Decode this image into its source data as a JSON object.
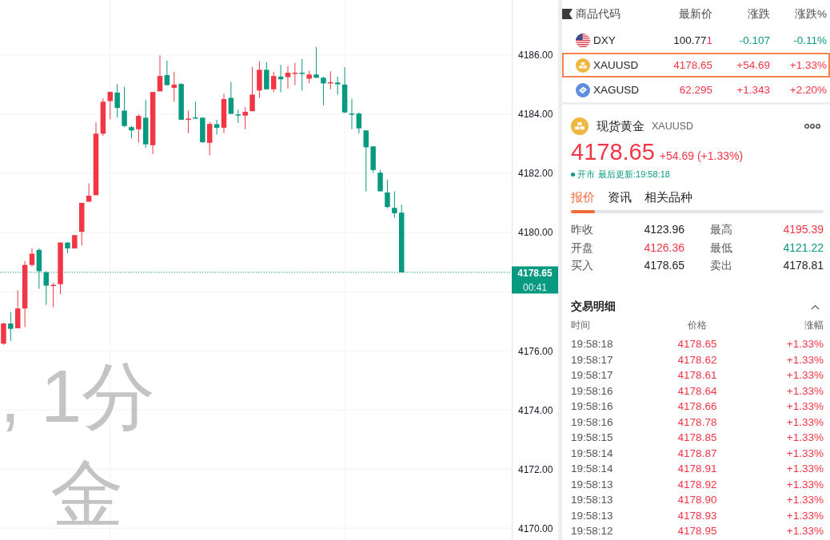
{
  "chart": {
    "watermark": [
      ", 1分",
      "金"
    ],
    "countdown": "00:41",
    "chart_data": {
      "type": "candlestick",
      "grid": true,
      "ylim": [
        4169.6,
        4187.86
      ],
      "yticks": [
        {
          "value": 4170,
          "label": "4170.00"
        },
        {
          "value": 4172,
          "label": "4172.00"
        },
        {
          "value": 4174,
          "label": "4174.00"
        },
        {
          "value": 4176,
          "label": "4176.00"
        },
        {
          "value": 4180,
          "label": "4180.00"
        },
        {
          "value": 4182,
          "label": "4182.00"
        },
        {
          "value": 4184,
          "label": "4184.00"
        },
        {
          "value": 4186,
          "label": "4186.00"
        }
      ],
      "ohlc": [
        [
          4176.24,
          4176.95,
          4176.2,
          4176.92
        ],
        [
          4176.92,
          4177.3,
          4176.33,
          4176.74
        ],
        [
          4176.76,
          4178.04,
          4176.76,
          4177.43
        ],
        [
          4177.43,
          4179.03,
          4176.8,
          4178.9
        ],
        [
          4178.9,
          4179.46,
          4178.85,
          4179.28
        ],
        [
          4179.41,
          4179.46,
          4178.09,
          4178.69
        ],
        [
          4178.65,
          4178.69,
          4177.55,
          4178.2
        ],
        [
          4178.2,
          4178.29,
          4177.47,
          4178.23
        ],
        [
          4178.25,
          4179.66,
          4177.91,
          4179.66
        ],
        [
          4179.66,
          4179.66,
          4179.3,
          4179.46
        ],
        [
          4179.46,
          4179.91,
          4179.46,
          4179.91
        ],
        [
          4180.02,
          4181.0,
          4179.56,
          4181.0
        ],
        [
          4181.04,
          4181.66,
          4181.04,
          4181.24
        ],
        [
          4181.26,
          4183.72,
          4181.26,
          4183.34
        ],
        [
          4183.34,
          4184.53,
          4183.27,
          4184.42
        ],
        [
          4184.44,
          4184.77,
          4183.83,
          4184.75
        ],
        [
          4184.73,
          4185.02,
          4183.88,
          4184.21
        ],
        [
          4184.12,
          4184.93,
          4183.56,
          4183.6
        ],
        [
          4183.56,
          4183.6,
          4183.18,
          4183.45
        ],
        [
          4183.49,
          4183.99,
          4183.04,
          4183.94
        ],
        [
          4183.88,
          4184.48,
          4182.86,
          4182.98
        ],
        [
          4182.95,
          4184.75,
          4182.65,
          4184.75
        ],
        [
          4184.77,
          4185.99,
          4184.77,
          4185.29
        ],
        [
          4185.32,
          4185.81,
          4184.98,
          4184.98
        ],
        [
          4184.89,
          4185.43,
          4184.42,
          4185.0
        ],
        [
          4185.02,
          4185.05,
          4183.81,
          4183.81
        ],
        [
          4183.82,
          4184.12,
          4183.36,
          4183.85
        ],
        [
          4183.89,
          4184.42,
          4183.86,
          4183.86
        ],
        [
          4183.88,
          4183.88,
          4183.03,
          4183.05
        ],
        [
          4183.03,
          4183.74,
          4182.61,
          4183.67
        ],
        [
          4183.66,
          4183.81,
          4183.31,
          4183.54
        ],
        [
          4183.54,
          4184.69,
          4183.36,
          4184.51
        ],
        [
          4184.55,
          4185.09,
          4184.01,
          4184.01
        ],
        [
          4183.99,
          4184.15,
          4183.7,
          4183.95
        ],
        [
          4183.95,
          4184.24,
          4183.49,
          4184.08
        ],
        [
          4184.1,
          4185.59,
          4184.1,
          4184.66
        ],
        [
          4184.8,
          4185.79,
          4184.55,
          4185.5
        ],
        [
          4185.5,
          4185.76,
          4184.84,
          4184.84
        ],
        [
          4184.84,
          4185.43,
          4184.74,
          4185.29
        ],
        [
          4185.27,
          4185.67,
          4184.74,
          4185.18
        ],
        [
          4185.25,
          4185.63,
          4184.87,
          4185.4
        ],
        [
          4185.38,
          4185.73,
          4184.98,
          4185.4
        ],
        [
          4185.4,
          4185.86,
          4184.8,
          4185.37
        ],
        [
          4185.2,
          4185.47,
          4185.04,
          4185.34
        ],
        [
          4185.34,
          4186.27,
          4185.23,
          4185.23
        ],
        [
          4185.23,
          4185.27,
          4184.3,
          4185.04
        ],
        [
          4185.05,
          4185.45,
          4184.84,
          4185.08
        ],
        [
          4185.07,
          4185.27,
          4184.66,
          4185.01
        ],
        [
          4185.0,
          4185.59,
          4184.03,
          4184.06
        ],
        [
          4184.02,
          4184.51,
          4183.49,
          4183.99
        ],
        [
          4184.02,
          4184.06,
          4183.34,
          4183.52
        ],
        [
          4183.45,
          4183.45,
          4181.39,
          4182.88
        ],
        [
          4182.91,
          4182.91,
          4182.01,
          4182.11
        ],
        [
          4182.02,
          4182.11,
          4181.39,
          4181.39
        ],
        [
          4181.35,
          4181.78,
          4180.82,
          4180.86
        ],
        [
          4180.83,
          4181.39,
          4180.49,
          4180.65
        ],
        [
          4180.67,
          4180.94,
          4178.65,
          4178.65
        ],
        null,
        null,
        null,
        null,
        null,
        null,
        null,
        null,
        null,
        null,
        null,
        null,
        null,
        null,
        null
      ],
      "ref_lines": [
        {
          "axis": "y",
          "value": 4178.65,
          "label": "4178.65",
          "color": "#089981",
          "line_style": "dotted"
        }
      ]
    }
  },
  "watchlist": {
    "columns": [
      "商品代码",
      "最新价",
      "涨跌",
      "涨跌%"
    ],
    "rows": [
      {
        "kind": "index",
        "symbol": "DXY",
        "price_parts": [
          {
            "text": "100.77",
            "color": "#222222"
          },
          {
            "text": "1",
            "color": "#f23645"
          }
        ],
        "change": "-0.107",
        "change_pct": "-0.11%",
        "color": "#089981",
        "selected": false
      },
      {
        "kind": "gold",
        "symbol": "XAUUSD",
        "price_parts": [
          {
            "text": "4178.65",
            "color": "#f23645"
          }
        ],
        "change": "+54.69",
        "change_pct": "+1.33%",
        "color": "#f23645",
        "selected": true
      },
      {
        "kind": "silver",
        "symbol": "XAGUSD",
        "price_parts": [
          {
            "text": "62.295",
            "color": "#f23645"
          }
        ],
        "change": "+1.343",
        "change_pct": "+2.20%",
        "color": "#f23645",
        "selected": false
      }
    ]
  },
  "quote": {
    "kind": "gold",
    "name": "现货黄金",
    "symbol": "XAUUSD",
    "price": "4178.65",
    "change": "+54.69 (+1.33%)",
    "color": "#f23645",
    "market_open": true,
    "status": "开市",
    "updated": "最后更新:19:58:18",
    "tabs": [
      {
        "label": "报价",
        "selected": true
      },
      {
        "label": "资讯",
        "selected": false
      },
      {
        "label": "相关品种",
        "selected": false
      }
    ],
    "stats": [
      {
        "label": "昨收",
        "value": "4123.96",
        "color": "#222222"
      },
      {
        "label": "最高",
        "value": "4195.39",
        "color": "#f23645"
      },
      {
        "label": "开盘",
        "value": "4126.36",
        "color": "#f23645"
      },
      {
        "label": "最低",
        "value": "4121.22",
        "color": "#089981"
      },
      {
        "label": "买入",
        "value": "4178.65",
        "color": "#222222"
      },
      {
        "label": "卖出",
        "value": "4178.81",
        "color": "#222222"
      }
    ]
  },
  "trades": {
    "title": "交易明细",
    "expanded": true,
    "columns": [
      "时间",
      "价格",
      "涨幅"
    ],
    "rows": [
      {
        "time": "19:58:18",
        "price": "4178.65",
        "change_pct": "+1.33%",
        "color": "#f23645"
      },
      {
        "time": "19:58:17",
        "price": "4178.62",
        "change_pct": "+1.33%",
        "color": "#f23645"
      },
      {
        "time": "19:58:17",
        "price": "4178.61",
        "change_pct": "+1.33%",
        "color": "#f23645"
      },
      {
        "time": "19:58:16",
        "price": "4178.64",
        "change_pct": "+1.33%",
        "color": "#f23645"
      },
      {
        "time": "19:58:16",
        "price": "4178.66",
        "change_pct": "+1.33%",
        "color": "#f23645"
      },
      {
        "time": "19:58:16",
        "price": "4178.78",
        "change_pct": "+1.33%",
        "color": "#f23645"
      },
      {
        "time": "19:58:15",
        "price": "4178.85",
        "change_pct": "+1.33%",
        "color": "#f23645"
      },
      {
        "time": "19:58:14",
        "price": "4178.87",
        "change_pct": "+1.33%",
        "color": "#f23645"
      },
      {
        "time": "19:58:14",
        "price": "4178.91",
        "change_pct": "+1.33%",
        "color": "#f23645"
      },
      {
        "time": "19:58:13",
        "price": "4178.92",
        "change_pct": "+1.33%",
        "color": "#f23645"
      },
      {
        "time": "19:58:13",
        "price": "4178.90",
        "change_pct": "+1.33%",
        "color": "#f23645"
      },
      {
        "time": "19:58:13",
        "price": "4178.93",
        "change_pct": "+1.33%",
        "color": "#f23645"
      },
      {
        "time": "19:58:12",
        "price": "4178.95",
        "change_pct": "+1.33%",
        "color": "#f23645"
      }
    ]
  }
}
